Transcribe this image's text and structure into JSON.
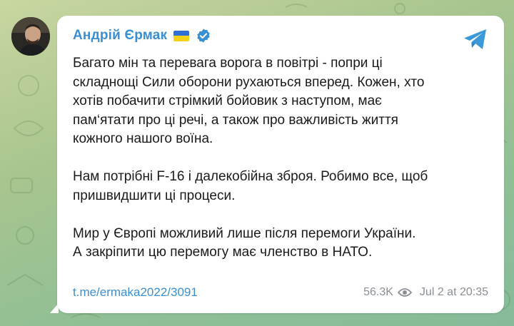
{
  "post": {
    "author": "Андрій Єрмак",
    "author_flag_icon": "ukraine-flag-icon",
    "verified_icon": "verified-badge-icon",
    "platform_icon": "telegram-icon",
    "paragraphs": [
      [
        "Багато мін та перевага ворога в повітрі - попри ці",
        "складнощі Сили оборони рухаються вперед. Кожен, хто",
        "хотів побачити стрімкий бойовик з наступом, має",
        "пам‘ятати про ці речі, а також про важливість життя",
        "кожного нашого воїна."
      ],
      [
        "Нам потрібні F-16 і далекобійна зброя. Робимо все, щоб",
        "пришвидшити ці процеси."
      ],
      [
        "Мир у Європі можливий лише після перемоги України.",
        "А закріпити цю перемогу має членство в НАТО."
      ]
    ],
    "link": "t.me/ermaka2022/3091",
    "views": "56.3K",
    "timestamp": "Jul 2 at 20:35"
  },
  "colors": {
    "link_blue": "#3a8fd0",
    "meta_gray": "#8a8f94",
    "background_green": "#a9c58f"
  }
}
